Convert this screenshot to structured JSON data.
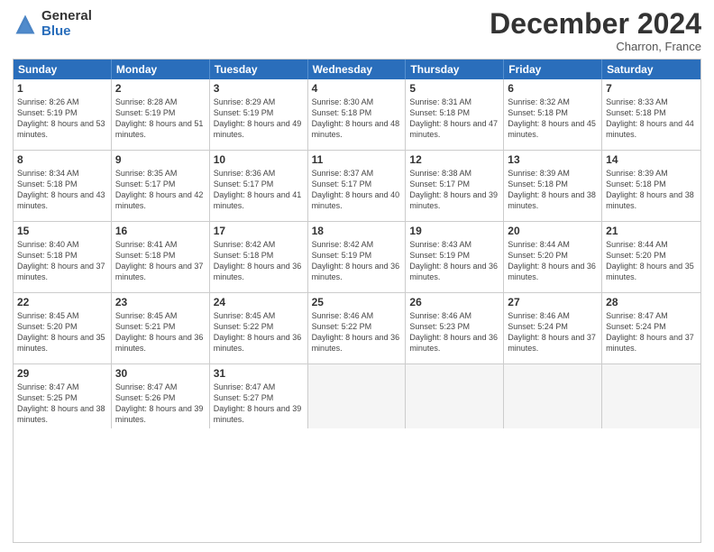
{
  "logo": {
    "general": "General",
    "blue": "Blue"
  },
  "title": "December 2024",
  "subtitle": "Charron, France",
  "days": [
    "Sunday",
    "Monday",
    "Tuesday",
    "Wednesday",
    "Thursday",
    "Friday",
    "Saturday"
  ],
  "weeks": [
    [
      {
        "day": "1",
        "rise": "8:26 AM",
        "set": "5:19 PM",
        "daylight": "8 hours and 53 minutes."
      },
      {
        "day": "2",
        "rise": "8:28 AM",
        "set": "5:19 PM",
        "daylight": "8 hours and 51 minutes."
      },
      {
        "day": "3",
        "rise": "8:29 AM",
        "set": "5:19 PM",
        "daylight": "8 hours and 49 minutes."
      },
      {
        "day": "4",
        "rise": "8:30 AM",
        "set": "5:18 PM",
        "daylight": "8 hours and 48 minutes."
      },
      {
        "day": "5",
        "rise": "8:31 AM",
        "set": "5:18 PM",
        "daylight": "8 hours and 47 minutes."
      },
      {
        "day": "6",
        "rise": "8:32 AM",
        "set": "5:18 PM",
        "daylight": "8 hours and 45 minutes."
      },
      {
        "day": "7",
        "rise": "8:33 AM",
        "set": "5:18 PM",
        "daylight": "8 hours and 44 minutes."
      }
    ],
    [
      {
        "day": "8",
        "rise": "8:34 AM",
        "set": "5:18 PM",
        "daylight": "8 hours and 43 minutes."
      },
      {
        "day": "9",
        "rise": "8:35 AM",
        "set": "5:17 PM",
        "daylight": "8 hours and 42 minutes."
      },
      {
        "day": "10",
        "rise": "8:36 AM",
        "set": "5:17 PM",
        "daylight": "8 hours and 41 minutes."
      },
      {
        "day": "11",
        "rise": "8:37 AM",
        "set": "5:17 PM",
        "daylight": "8 hours and 40 minutes."
      },
      {
        "day": "12",
        "rise": "8:38 AM",
        "set": "5:17 PM",
        "daylight": "8 hours and 39 minutes."
      },
      {
        "day": "13",
        "rise": "8:39 AM",
        "set": "5:18 PM",
        "daylight": "8 hours and 38 minutes."
      },
      {
        "day": "14",
        "rise": "8:39 AM",
        "set": "5:18 PM",
        "daylight": "8 hours and 38 minutes."
      }
    ],
    [
      {
        "day": "15",
        "rise": "8:40 AM",
        "set": "5:18 PM",
        "daylight": "8 hours and 37 minutes."
      },
      {
        "day": "16",
        "rise": "8:41 AM",
        "set": "5:18 PM",
        "daylight": "8 hours and 37 minutes."
      },
      {
        "day": "17",
        "rise": "8:42 AM",
        "set": "5:18 PM",
        "daylight": "8 hours and 36 minutes."
      },
      {
        "day": "18",
        "rise": "8:42 AM",
        "set": "5:19 PM",
        "daylight": "8 hours and 36 minutes."
      },
      {
        "day": "19",
        "rise": "8:43 AM",
        "set": "5:19 PM",
        "daylight": "8 hours and 36 minutes."
      },
      {
        "day": "20",
        "rise": "8:44 AM",
        "set": "5:20 PM",
        "daylight": "8 hours and 36 minutes."
      },
      {
        "day": "21",
        "rise": "8:44 AM",
        "set": "5:20 PM",
        "daylight": "8 hours and 35 minutes."
      }
    ],
    [
      {
        "day": "22",
        "rise": "8:45 AM",
        "set": "5:20 PM",
        "daylight": "8 hours and 35 minutes."
      },
      {
        "day": "23",
        "rise": "8:45 AM",
        "set": "5:21 PM",
        "daylight": "8 hours and 36 minutes."
      },
      {
        "day": "24",
        "rise": "8:45 AM",
        "set": "5:22 PM",
        "daylight": "8 hours and 36 minutes."
      },
      {
        "day": "25",
        "rise": "8:46 AM",
        "set": "5:22 PM",
        "daylight": "8 hours and 36 minutes."
      },
      {
        "day": "26",
        "rise": "8:46 AM",
        "set": "5:23 PM",
        "daylight": "8 hours and 36 minutes."
      },
      {
        "day": "27",
        "rise": "8:46 AM",
        "set": "5:24 PM",
        "daylight": "8 hours and 37 minutes."
      },
      {
        "day": "28",
        "rise": "8:47 AM",
        "set": "5:24 PM",
        "daylight": "8 hours and 37 minutes."
      }
    ],
    [
      {
        "day": "29",
        "rise": "8:47 AM",
        "set": "5:25 PM",
        "daylight": "8 hours and 38 minutes."
      },
      {
        "day": "30",
        "rise": "8:47 AM",
        "set": "5:26 PM",
        "daylight": "8 hours and 39 minutes."
      },
      {
        "day": "31",
        "rise": "8:47 AM",
        "set": "5:27 PM",
        "daylight": "8 hours and 39 minutes."
      },
      null,
      null,
      null,
      null
    ]
  ],
  "labels": {
    "sunrise": "Sunrise:",
    "sunset": "Sunset:",
    "daylight": "Daylight:"
  }
}
